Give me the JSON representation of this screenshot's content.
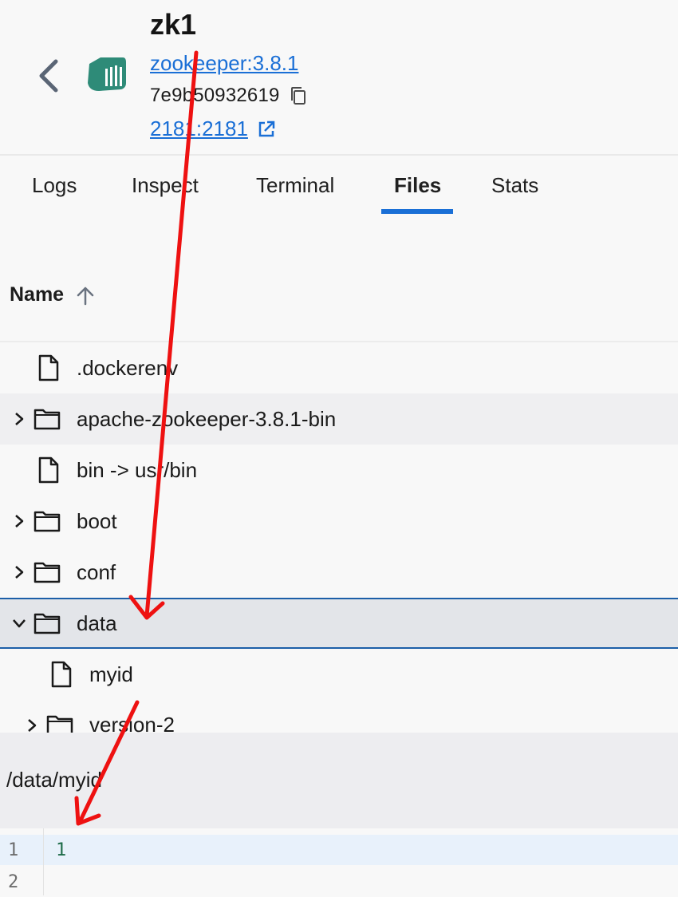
{
  "header": {
    "back_icon": "chevron-left-icon",
    "logo_icon": "docker-whale-icon",
    "title": "zk1",
    "image": "zookeeper:3.8.1",
    "container_id": "7e9b50932619",
    "copy_icon": "copy-icon",
    "port": "2181:2181",
    "external_link_icon": "external-link-icon"
  },
  "tabs": [
    {
      "label": "Logs",
      "active": false
    },
    {
      "label": "Inspect",
      "active": false
    },
    {
      "label": "Terminal",
      "active": false
    },
    {
      "label": "Files",
      "active": true
    },
    {
      "label": "Stats",
      "active": false
    }
  ],
  "table": {
    "column_name": "Name",
    "sort_icon": "arrow-up-icon",
    "rows": [
      {
        "name": ".dockerenv",
        "type": "file"
      },
      {
        "name": "apache-zookeeper-3.8.1-bin",
        "type": "folder",
        "expanded": false
      },
      {
        "name": "bin -> usr/bin",
        "type": "file"
      },
      {
        "name": "boot",
        "type": "folder",
        "expanded": false
      },
      {
        "name": "conf",
        "type": "folder",
        "expanded": false
      },
      {
        "name": "data",
        "type": "folder",
        "expanded": true,
        "selected": true
      },
      {
        "name": "myid",
        "type": "file",
        "child": true
      },
      {
        "name": "version-2",
        "type": "folder",
        "expanded": false,
        "child": true
      }
    ]
  },
  "file_view": {
    "path": "/data/myid",
    "lines": [
      {
        "number": "1",
        "content": "1"
      },
      {
        "number": "2",
        "content": ""
      }
    ]
  },
  "colors": {
    "link": "#1a6fd6",
    "tab_indicator": "#1a6fd6",
    "annotation_arrow": "#ee1111"
  }
}
